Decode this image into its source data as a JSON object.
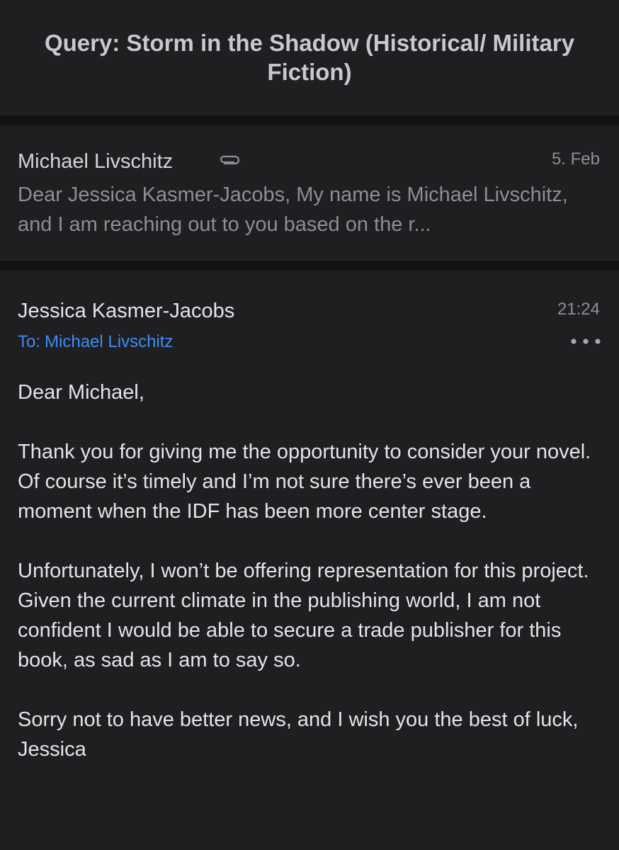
{
  "thread": {
    "subject": "Query: Storm in the Shadow (Historical/ Military Fiction)"
  },
  "previous_message": {
    "sender": "Michael Livschitz",
    "date": "5. Feb",
    "snippet": "Dear Jessica Kasmer-Jacobs, My name is Michael Livschitz, and I am reaching out to you based on the r...",
    "attachment_icon": "paperclip-icon"
  },
  "message": {
    "sender": "Jessica Kasmer-Jacobs",
    "time": "21:24",
    "to_label": "To:",
    "recipient": "Michael Livschitz",
    "more_icon": "ellipsis-icon",
    "body": {
      "greeting": "Dear Michael,",
      "paragraph_1": "Thank you for giving me the opportunity to consider your novel. Of course it’s timely and I’m not sure there’s ever been a moment when the IDF has been more center stage.",
      "paragraph_2": "Unfortunately, I won’t be offering representation for this project. Given the current climate in the publishing world, I am not confident I would be able to secure a trade publisher for this book, as sad as I am to say so.",
      "closing": "Sorry not to have better news, and I wish you the best of luck,",
      "signature": "Jessica"
    }
  },
  "colors": {
    "background": "#1f1f21",
    "separator": "#121214",
    "link_blue": "#3d8cf2",
    "secondary_text": "#8e8e93"
  }
}
